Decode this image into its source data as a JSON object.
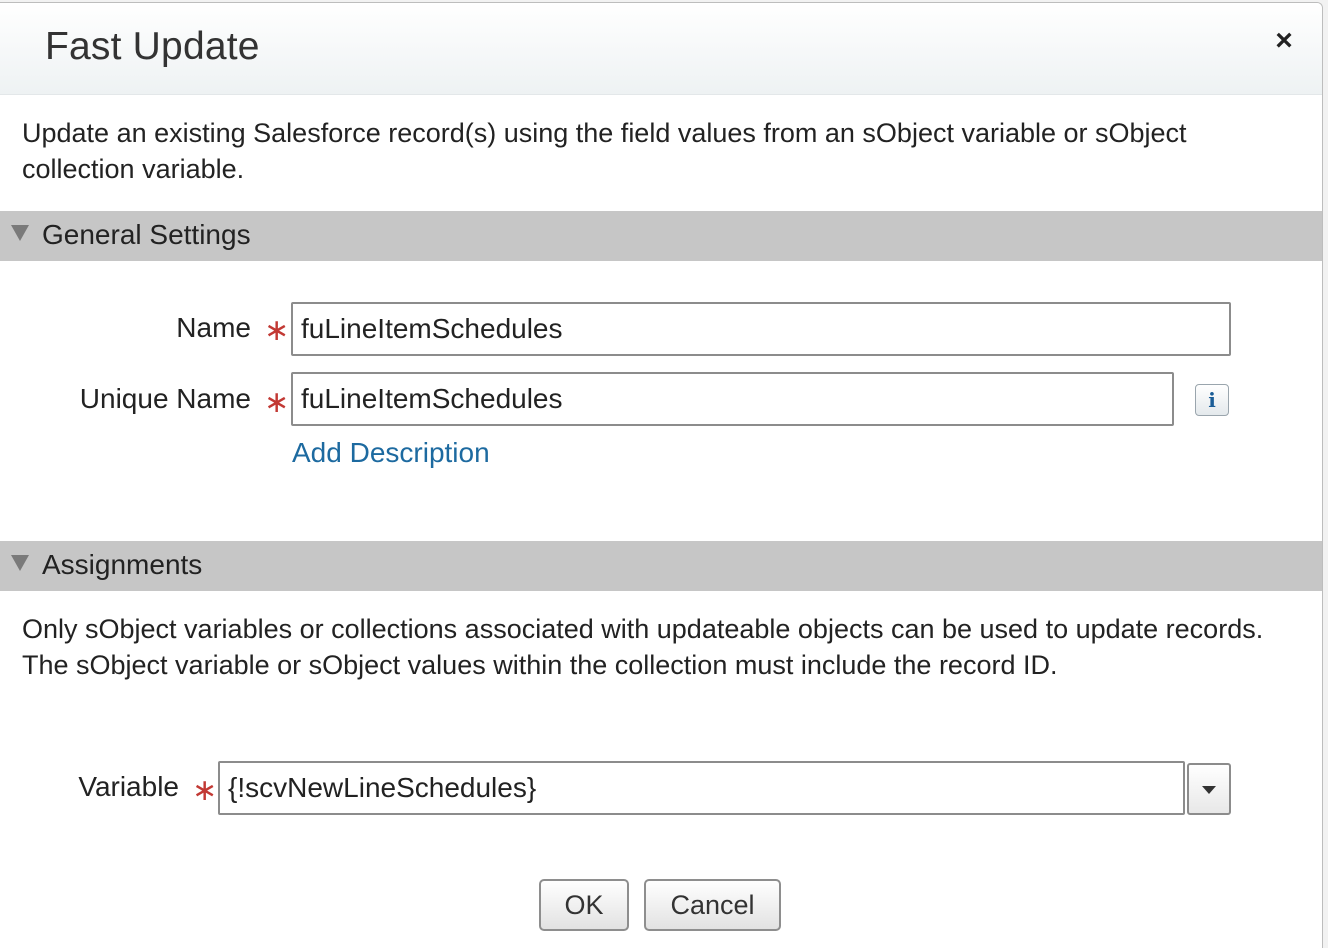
{
  "dialog": {
    "title": "Fast Update",
    "close_label": "×",
    "description": "Update an existing Salesforce record(s) using the field values from an sObject variable or sObject collection variable."
  },
  "general_settings": {
    "header": "General Settings",
    "name_label": "Name",
    "name_value": "fuLineItemSchedules",
    "unique_name_label": "Unique Name",
    "unique_name_value": "fuLineItemSchedules",
    "info_label": "i",
    "add_description_link": "Add Description",
    "required_marker": "∗"
  },
  "assignments": {
    "header": "Assignments",
    "description": "Only sObject variables or collections associated with updateable objects can be used to update records. The sObject variable or sObject values within the collection must include the record ID.",
    "variable_label": "Variable",
    "variable_value": "{!scvNewLineSchedules}"
  },
  "footer": {
    "ok_label": "OK",
    "cancel_label": "Cancel"
  },
  "colors": {
    "section_header_bg": "#c6c6c6",
    "required_marker": "#c23934",
    "link": "#1d6aa0"
  },
  "icons": {
    "close": "close-icon",
    "collapse": "collapse-triangle-icon",
    "info": "info-icon",
    "dropdown": "chevron-down-icon"
  }
}
